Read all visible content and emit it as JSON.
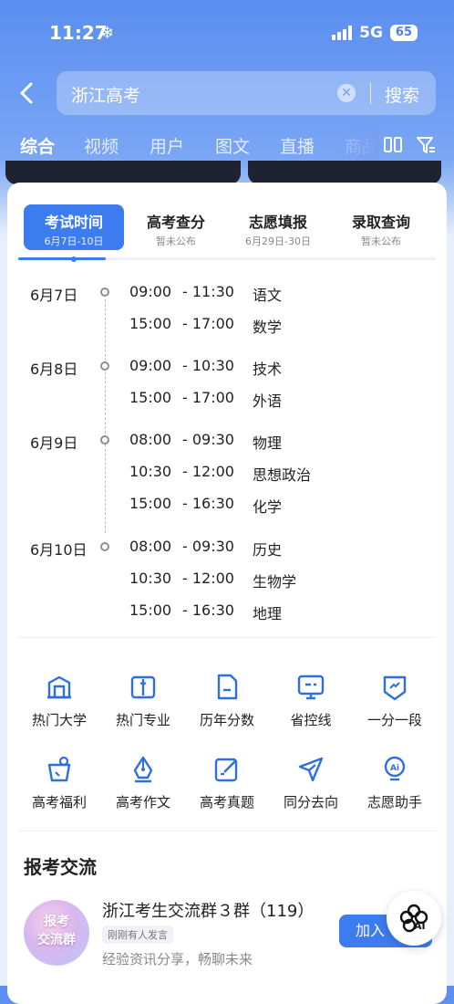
{
  "status_bar": {
    "time": "11:27",
    "network": "5G",
    "battery": "65"
  },
  "search": {
    "query": "浙江高考",
    "button": "搜索"
  },
  "filter_tabs": {
    "items": [
      "综合",
      "视频",
      "用户",
      "图文",
      "直播",
      "商品"
    ],
    "active": "综合"
  },
  "exam": {
    "segments": [
      {
        "label": "考试时间",
        "sub": "6月7日-10日"
      },
      {
        "label": "高考查分",
        "sub": "暂未公布"
      },
      {
        "label": "志愿填报",
        "sub": "6月29日-30日"
      },
      {
        "label": "录取查询",
        "sub": "暂未公布"
      }
    ],
    "schedule": [
      {
        "date": "6月7日",
        "sessions": [
          {
            "start": "09:00",
            "end": "- 11:30",
            "subject": "语文"
          },
          {
            "start": "15:00",
            "end": "- 17:00",
            "subject": "数学"
          }
        ]
      },
      {
        "date": "6月8日",
        "sessions": [
          {
            "start": "09:00",
            "end": "- 10:30",
            "subject": "技术"
          },
          {
            "start": "15:00",
            "end": "- 17:00",
            "subject": "外语"
          }
        ]
      },
      {
        "date": "6月9日",
        "sessions": [
          {
            "start": "08:00",
            "end": "- 09:30",
            "subject": "物理"
          },
          {
            "start": "10:30",
            "end": "- 12:00",
            "subject": "思想政治"
          },
          {
            "start": "15:00",
            "end": "- 16:30",
            "subject": "化学"
          }
        ]
      },
      {
        "date": "6月10日",
        "sessions": [
          {
            "start": "08:00",
            "end": "- 09:30",
            "subject": "历史"
          },
          {
            "start": "10:30",
            "end": "- 12:00",
            "subject": "生物学"
          },
          {
            "start": "15:00",
            "end": "- 16:30",
            "subject": "地理"
          }
        ]
      }
    ]
  },
  "tools": [
    {
      "label": "热门大学",
      "icon": "university-icon"
    },
    {
      "label": "热门专业",
      "icon": "book-icon"
    },
    {
      "label": "历年分数",
      "icon": "score-doc-icon"
    },
    {
      "label": "省控线",
      "icon": "monitor-icon"
    },
    {
      "label": "一分一段",
      "icon": "badge-icon"
    },
    {
      "label": "高考福利",
      "icon": "gift-icon"
    },
    {
      "label": "高考作文",
      "icon": "pen-icon"
    },
    {
      "label": "高考真题",
      "icon": "edit-icon"
    },
    {
      "label": "同分去向",
      "icon": "send-icon"
    },
    {
      "label": "志愿助手",
      "icon": "ai-bulb-icon"
    }
  ],
  "exchange": {
    "title": "报考交流",
    "group": {
      "avatar_text": "报考交流群",
      "name": "浙江考生交流群３群（119）",
      "badge": "刚刚有人发言",
      "desc": "经验资讯分享，畅聊未来",
      "join": "加入"
    }
  },
  "ai_fab": "AI",
  "colors": {
    "accent": "#3d7cf0",
    "header": "#5b8ef0"
  }
}
